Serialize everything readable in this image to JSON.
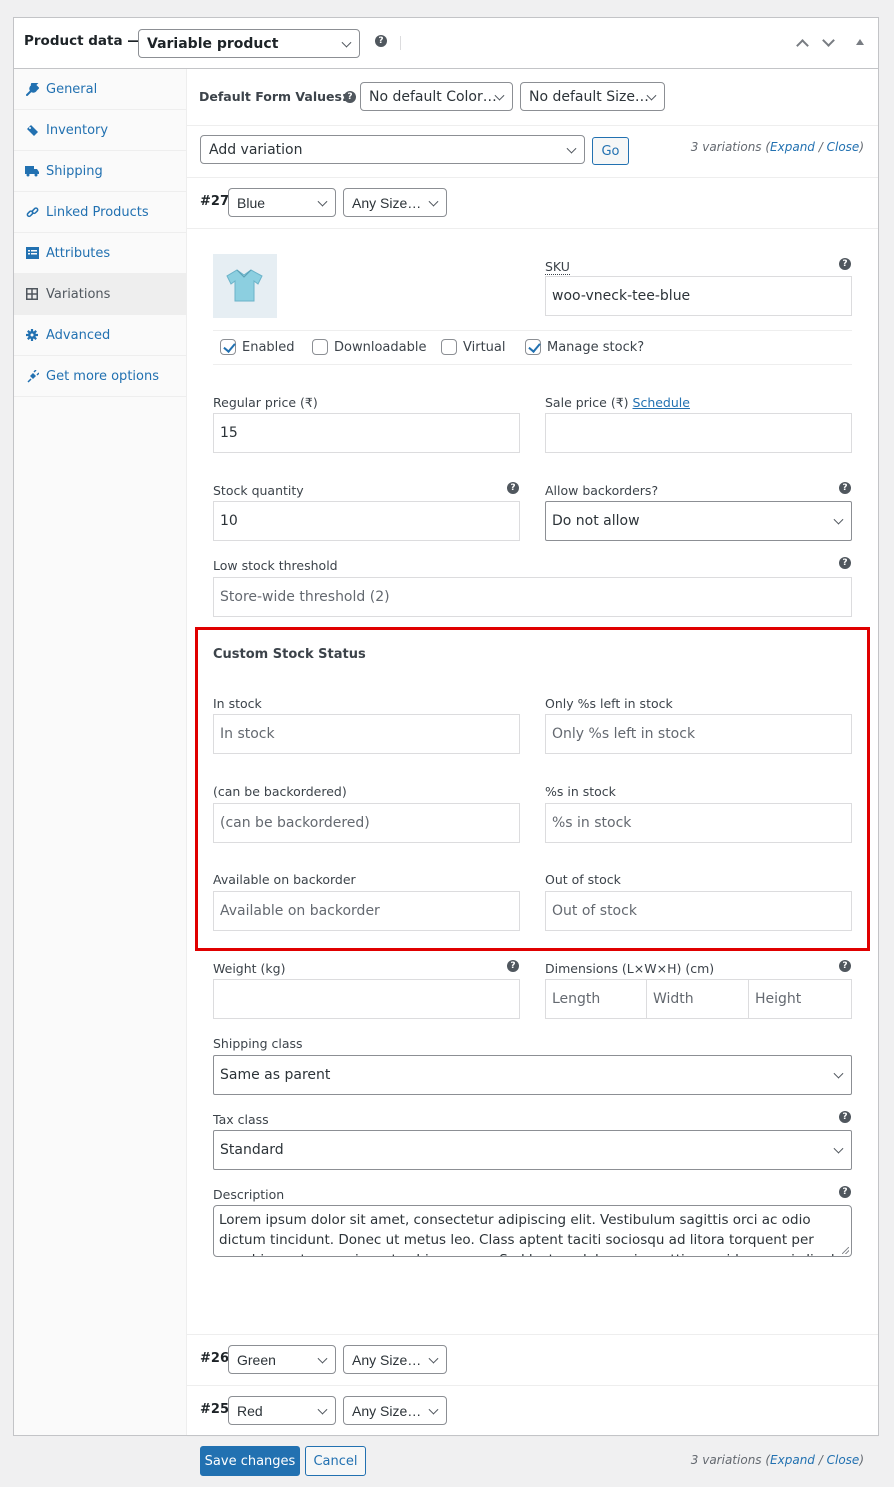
{
  "header": {
    "title": "Product data —",
    "product_type": "Variable product",
    "help_glyph": "?"
  },
  "sidebar": {
    "items": [
      {
        "label": "General",
        "icon": "wrench-icon"
      },
      {
        "label": "Inventory",
        "icon": "tag-icon"
      },
      {
        "label": "Shipping",
        "icon": "truck-icon"
      },
      {
        "label": "Linked Products",
        "icon": "link-icon"
      },
      {
        "label": "Attributes",
        "icon": "list-icon"
      },
      {
        "label": "Variations",
        "icon": "grid-icon",
        "active": true
      },
      {
        "label": "Advanced",
        "icon": "gear-icon"
      },
      {
        "label": "Get more options",
        "icon": "plugin-icon"
      }
    ]
  },
  "defaults": {
    "label": "Default Form Values:",
    "color_select": "No default Color…",
    "size_select": "No default Size…"
  },
  "toolbar": {
    "action_select": "Add variation",
    "go_label": "Go",
    "count_prefix": "3 variations (",
    "expand": "Expand",
    "slash": " / ",
    "close": "Close",
    "count_suffix": ")"
  },
  "variations": [
    {
      "id": "#27",
      "color": "Blue",
      "size": "Any Size…"
    },
    {
      "id": "#26",
      "color": "Green",
      "size": "Any Size…"
    },
    {
      "id": "#25",
      "color": "Red",
      "size": "Any Size…"
    }
  ],
  "variation_detail": {
    "sku_label": "SKU",
    "sku_value": "woo-vneck-tee-blue",
    "checkboxes": [
      {
        "label": "Enabled",
        "checked": true
      },
      {
        "label": "Downloadable",
        "checked": false
      },
      {
        "label": "Virtual",
        "checked": false
      },
      {
        "label": "Manage stock?",
        "checked": true
      }
    ],
    "regular_price_label": "Regular price (₹)",
    "regular_price_value": "15",
    "sale_price_label": "Sale price (₹)",
    "schedule_link": "Schedule",
    "sale_price_value": "",
    "stock_qty_label": "Stock quantity",
    "stock_qty_value": "10",
    "backorders_label": "Allow backorders?",
    "backorders_value": "Do not allow",
    "low_stock_label": "Low stock threshold",
    "low_stock_placeholder": "Store-wide threshold (2)",
    "custom_stock": {
      "title": "Custom Stock Status",
      "fields": [
        {
          "label": "In stock",
          "placeholder": "In stock"
        },
        {
          "label": "Only %s left in stock",
          "placeholder": "Only %s left in stock"
        },
        {
          "label": "(can be backordered)",
          "placeholder": "(can be backordered)"
        },
        {
          "label": "%s in stock",
          "placeholder": "%s in stock"
        },
        {
          "label": "Available on backorder",
          "placeholder": "Available on backorder"
        },
        {
          "label": "Out of stock",
          "placeholder": "Out of stock"
        }
      ]
    },
    "weight_label": "Weight (kg)",
    "weight_value": "",
    "dimensions_label": "Dimensions (L×W×H) (cm)",
    "length_placeholder": "Length",
    "width_placeholder": "Width",
    "height_placeholder": "Height",
    "shipping_class_label": "Shipping class",
    "shipping_class_value": "Same as parent",
    "tax_class_label": "Tax class",
    "tax_class_value": "Standard",
    "description_label": "Description",
    "description_value": "Lorem ipsum dolor sit amet, consectetur adipiscing elit. Vestibulum sagittis orci ac odio dictum tincidunt. Donec ut metus leo. Class aptent taciti sociosqu ad litora torquent per conubia nostra, per inceptos himenaeos. Sed luctus, dolor quis mattis gravida, mauris ligula vestibulum nisi, et commodo."
  },
  "footer": {
    "save_label": "Save changes",
    "cancel_label": "Cancel"
  },
  "colors": {
    "accent": "#2271b1",
    "highlight_border": "#e00000"
  }
}
